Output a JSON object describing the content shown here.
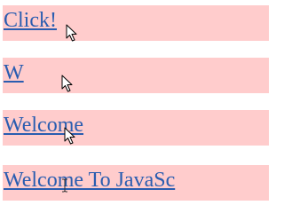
{
  "links": [
    {
      "label": "Click!"
    },
    {
      "label": "W"
    },
    {
      "label": "Welcome"
    },
    {
      "label": "Welcome To JavaSc"
    }
  ],
  "colors": {
    "row_background": "#ffcccc",
    "link_text": "#2a5db0"
  },
  "icons": {
    "pointer": "mouse-pointer-arrow-icon",
    "text_cursor": "text-cursor-ibeam-icon"
  }
}
